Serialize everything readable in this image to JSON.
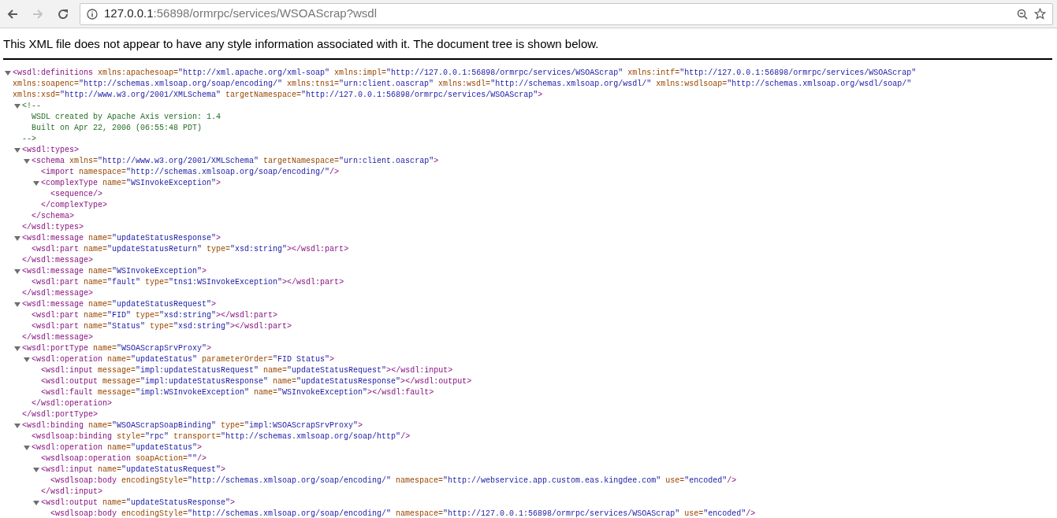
{
  "browser": {
    "back_enabled": true,
    "forward_enabled": false,
    "url_host": "127.0.0.1",
    "url_rest": ":56898/ormrpc/services/WSOAScrap?wsdl"
  },
  "notice": "This XML file does not appear to have any style information associated with it. The document tree is shown below.",
  "tree": [
    {
      "kind": "element",
      "expanded": true,
      "open": "<wsdl:definitions xmlns:apachesoap=\"http://xml.apache.org/xml-soap\" xmlns:impl=\"http://127.0.0.1:56898/ormrpc/services/WSOAScrap\" xmlns:intf=\"http://127.0.0.1:56898/ormrpc/services/WSOAScrap\" xmlns:soapenc=\"http://schemas.xmlsoap.org/soap/encoding/\" xmlns:tns1=\"urn:client.oascrap\" xmlns:wsdl=\"http://schemas.xmlsoap.org/wsdl/\" xmlns:wsdlsoap=\"http://schemas.xmlsoap.org/wsdl/soap/\" xmlns:xsd=\"http://www.w3.org/2001/XMLSchema\" targetNamespace=\"http://127.0.0.1:56898/ormrpc/services/WSOAScrap\">",
      "children": [
        {
          "kind": "comment",
          "expanded": true,
          "open": "<!--",
          "lines": [
            "WSDL created by Apache Axis version: 1.4",
            "Built on Apr 22, 2006 (06:55:48 PDT)"
          ],
          "close": "-->"
        },
        {
          "kind": "element",
          "expanded": true,
          "open": "<wsdl:types>",
          "close": "</wsdl:types>",
          "children": [
            {
              "kind": "element",
              "expanded": true,
              "open": "<schema xmlns=\"http://www.w3.org/2001/XMLSchema\" targetNamespace=\"urn:client.oascrap\">",
              "close": "</schema>",
              "children": [
                {
                  "kind": "leaf",
                  "text": "<import namespace=\"http://schemas.xmlsoap.org/soap/encoding/\"/>"
                },
                {
                  "kind": "element",
                  "expanded": true,
                  "open": "<complexType name=\"WSInvokeException\">",
                  "close": "</complexType>",
                  "children": [
                    {
                      "kind": "leaf",
                      "text": "<sequence/>"
                    }
                  ]
                }
              ]
            }
          ]
        },
        {
          "kind": "element",
          "expanded": true,
          "open": "<wsdl:message name=\"updateStatusResponse\">",
          "close": "</wsdl:message>",
          "children": [
            {
              "kind": "leaf",
              "text": "<wsdl:part name=\"updateStatusReturn\" type=\"xsd:string\"></wsdl:part>"
            }
          ]
        },
        {
          "kind": "element",
          "expanded": true,
          "open": "<wsdl:message name=\"WSInvokeException\">",
          "close": "</wsdl:message>",
          "children": [
            {
              "kind": "leaf",
              "text": "<wsdl:part name=\"fault\" type=\"tns1:WSInvokeException\"></wsdl:part>"
            }
          ]
        },
        {
          "kind": "element",
          "expanded": true,
          "open": "<wsdl:message name=\"updateStatusRequest\">",
          "close": "</wsdl:message>",
          "children": [
            {
              "kind": "leaf",
              "text": "<wsdl:part name=\"FID\" type=\"xsd:string\"></wsdl:part>"
            },
            {
              "kind": "leaf",
              "text": "<wsdl:part name=\"Status\" type=\"xsd:string\"></wsdl:part>"
            }
          ]
        },
        {
          "kind": "element",
          "expanded": true,
          "open": "<wsdl:portType name=\"WSOAScrapSrvProxy\">",
          "close": "</wsdl:portType>",
          "children": [
            {
              "kind": "element",
              "expanded": true,
              "open": "<wsdl:operation name=\"updateStatus\" parameterOrder=\"FID Status\">",
              "close": "</wsdl:operation>",
              "children": [
                {
                  "kind": "leaf",
                  "text": "<wsdl:input message=\"impl:updateStatusRequest\" name=\"updateStatusRequest\"></wsdl:input>"
                },
                {
                  "kind": "leaf",
                  "text": "<wsdl:output message=\"impl:updateStatusResponse\" name=\"updateStatusResponse\"></wsdl:output>"
                },
                {
                  "kind": "leaf",
                  "text": "<wsdl:fault message=\"impl:WSInvokeException\" name=\"WSInvokeException\"></wsdl:fault>"
                }
              ]
            }
          ]
        },
        {
          "kind": "element",
          "expanded": true,
          "open": "<wsdl:binding name=\"WSOAScrapSoapBinding\" type=\"impl:WSOAScrapSrvProxy\">",
          "children": [
            {
              "kind": "leaf",
              "text": "<wsdlsoap:binding style=\"rpc\" transport=\"http://schemas.xmlsoap.org/soap/http\"/>"
            },
            {
              "kind": "element",
              "expanded": true,
              "open": "<wsdl:operation name=\"updateStatus\">",
              "children": [
                {
                  "kind": "leaf",
                  "text": "<wsdlsoap:operation soapAction=\"\"/>"
                },
                {
                  "kind": "element",
                  "expanded": true,
                  "open": "<wsdl:input name=\"updateStatusRequest\">",
                  "close": "</wsdl:input>",
                  "children": [
                    {
                      "kind": "leaf",
                      "text": "<wsdlsoap:body encodingStyle=\"http://schemas.xmlsoap.org/soap/encoding/\" namespace=\"http://webservice.app.custom.eas.kingdee.com\" use=\"encoded\"/>"
                    }
                  ]
                },
                {
                  "kind": "element",
                  "expanded": true,
                  "open": "<wsdl:output name=\"updateStatusResponse\">",
                  "children": [
                    {
                      "kind": "leaf",
                      "text": "<wsdlsoap:body encodingStyle=\"http://schemas.xmlsoap.org/soap/encoding/\" namespace=\"http://127.0.0.1:56898/ormrpc/services/WSOAScrap\" use=\"encoded\"/>"
                    }
                  ]
                }
              ]
            }
          ]
        }
      ]
    }
  ]
}
